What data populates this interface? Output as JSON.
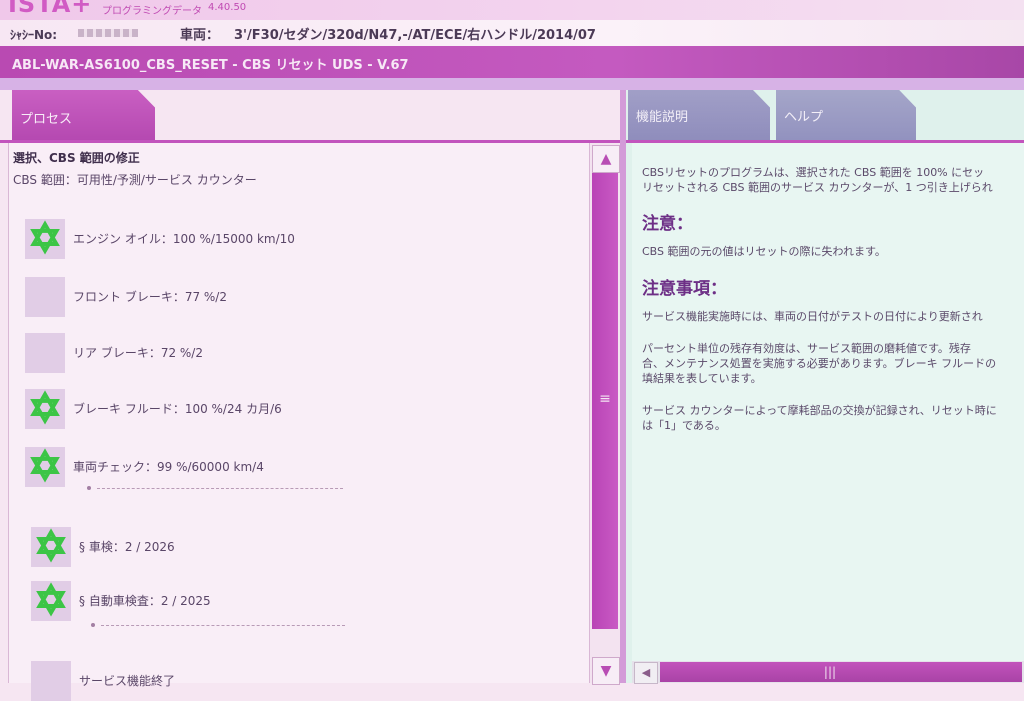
{
  "app": {
    "title": "ISTA+",
    "subtitle": "プログラミングデータ",
    "version": "4.40.50"
  },
  "vehicle": {
    "chassis_label": "ｼｬｼｰNo:",
    "vehicle_label": "車両：",
    "vehicle_value": "3'/F30/セダン/320d/N47,-/AT/ECE/右ハンドル/2014/07"
  },
  "module": {
    "title": "ABL-WAR-AS6100_CBS_RESET - CBS リセット UDS - V.67"
  },
  "left": {
    "tab_label": "プロセス",
    "section_title": "選択、CBS 範囲の修正",
    "section_subtitle": "CBS 範囲：可用性/予測/サービス カウンター",
    "items": [
      {
        "label": "エンジン オイル：100 %/15000 km/10",
        "starred": true
      },
      {
        "label": "フロント ブレーキ：77 %/2",
        "starred": false
      },
      {
        "label": "リア ブレーキ：72 %/2",
        "starred": false
      },
      {
        "label": "ブレーキ フルード：100 %/24 カ月/6",
        "starred": true
      },
      {
        "label": "車両チェック：99 %/60000 km/4",
        "starred": true
      },
      {
        "label": "§ 車検：2 / 2026",
        "starred": true
      },
      {
        "label": "§ 自動車検査：2 / 2025",
        "starred": true
      },
      {
        "label": "サービス機能終了",
        "starred": false
      }
    ]
  },
  "right": {
    "tabs": [
      {
        "label": "機能説明"
      },
      {
        "label": "ヘルプ"
      }
    ],
    "lines": [
      "CBSリセットのプログラムは、選択された CBS 範囲を 100% にセッ",
      "リセットされる CBS 範囲のサービス カウンターが、1 つ引き上げられ"
    ],
    "heading_caution": "注意：",
    "caution_text": "CBS 範囲の元の値はリセットの際に失われます。",
    "heading_notes": "注意事項：",
    "notes": [
      "サービス機能実施時には、車両の日付がテストの日付により更新され",
      "パーセント単位の残存有効度は、サービス範囲の磨耗値です。残存",
      "合、メンテナンス処置を実施する必要があります。ブレーキ フルードの",
      "填結果を表しています。",
      "サービス カウンターによって摩耗部品の交換が記録され、リセット時に",
      "は「1」である。"
    ]
  },
  "icons": {
    "star": "star-icon",
    "scroll_up": "arrow-up-icon",
    "scroll_down": "arrow-down-icon",
    "scroll_left": "arrow-left-icon"
  },
  "colors": {
    "accent": "#c254bd",
    "star": "#3cc546",
    "tab_inactive": "#9b99c5"
  }
}
